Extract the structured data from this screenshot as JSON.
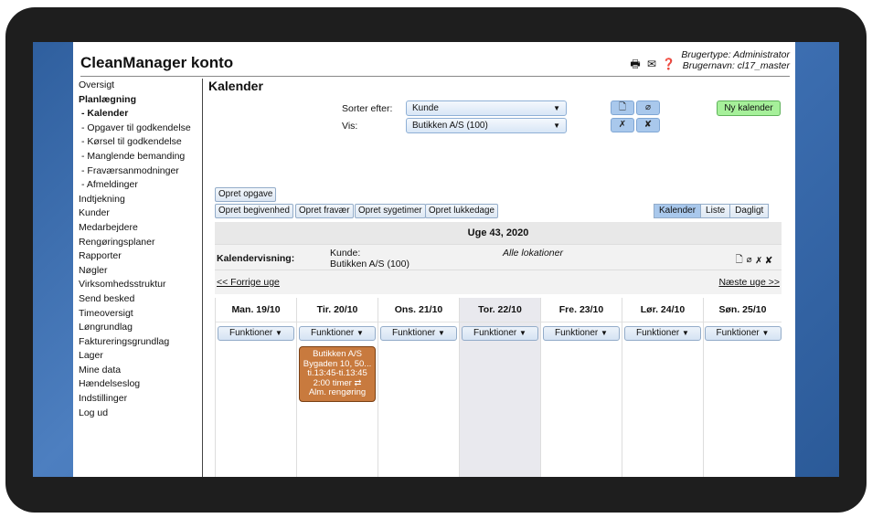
{
  "header": {
    "title": "CleanManager konto",
    "user_type": "Brugertype: Administrator",
    "user_name": "Brugernavn: cl17_master"
  },
  "nav": [
    "Oversigt",
    "Planlægning",
    "- Kalender",
    "- Opgaver til godkendelse",
    "- Kørsel til godkendelse",
    "- Manglende bemanding",
    "- Fraværsanmodninger",
    "- Afmeldinger",
    "Indtjekning",
    "Kunder",
    "Medarbejdere",
    "Rengøringsplaner",
    "Rapporter",
    "Nøgler",
    "Virksomhedsstruktur",
    "Send besked",
    "Timeoversigt",
    "Løngrundlag",
    "Faktureringsgrundlag",
    "Lager",
    "Mine data",
    "Hændelseslog",
    "Indstillinger",
    "Log ud"
  ],
  "main": {
    "title": "Kalender",
    "sort_label": "Sorter efter:",
    "sort_value": "Kunde",
    "show_label": "Vis:",
    "show_value": "Butikken A/S (100)",
    "new_calendar": "Ny kalender",
    "create_task": "Opret opgave",
    "create_buttons": [
      "Opret begivenhed",
      "Opret fravær",
      "Opret sygetimer",
      "Opret lukkedage"
    ],
    "view_tabs": [
      "Kalender",
      "Liste",
      "Dagligt"
    ],
    "week_title": "Uge 43, 2020",
    "calview_label": "Kalendervisning:",
    "customer_label": "Kunde:",
    "customer_value": "Butikken A/S (100)",
    "locations": "Alle lokationer",
    "prev_week": "<< Forrige uge",
    "next_week": "Næste uge >>",
    "functions_label": "Funktioner"
  },
  "days": [
    "Man. 19/10",
    "Tir. 20/10",
    "Ons. 21/10",
    "Tor. 22/10",
    "Fre. 23/10",
    "Lør. 24/10",
    "Søn. 25/10"
  ],
  "event": {
    "line1": "Butikken A/S",
    "line2": "Bygaden 10, 50...",
    "line3": "ti.13:45-ti.13:45",
    "line4": "2:00 timer ⇄",
    "line5": "Alm. rengøring"
  },
  "colors": {
    "accent_blue": "#a9c8ec",
    "new_calendar_green": "#a6f09a",
    "event_orange": "#c87a3e"
  }
}
